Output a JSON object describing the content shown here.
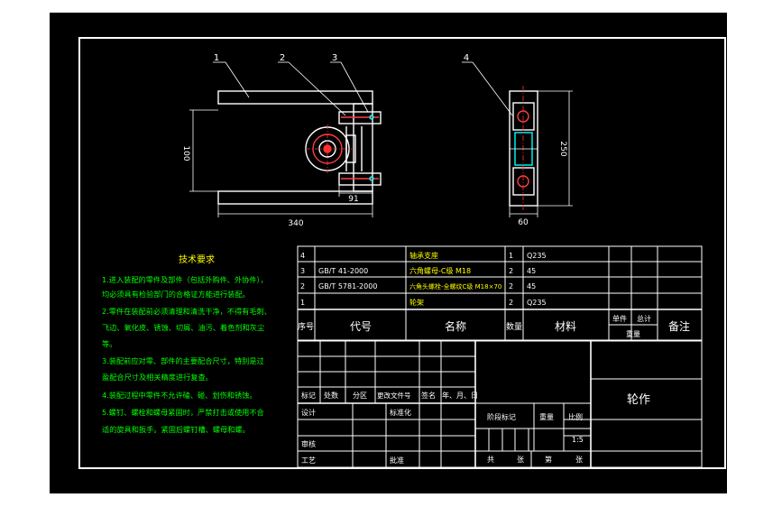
{
  "balloons": [
    "1",
    "2",
    "3",
    "4"
  ],
  "dimensions": {
    "height_left": "100",
    "width_91": "91",
    "width_total": "340",
    "height_right": "250",
    "width_60": "60"
  },
  "tech_requirements": {
    "title": "技术要求",
    "lines": [
      "1.进入装配的零件及部件（包括外购件、外协件），",
      "均必须具有检验部门的合格证方能进行装配。",
      "2.零件在装配前必须清理和清洗干净，不得有毛刺、",
      "飞边、氧化皮、锈蚀、切屑、油污、着色剂和灰尘",
      "等。",
      "3.装配前应对零、部件的主要配合尺寸，特别是过",
      "盈配合尺寸及相关精度进行复查。",
      "4.装配过程中零件不允许磕、碰、划伤和锈蚀。",
      "5.螺钉、螺栓和螺母紧固时，严禁打击或使用不合",
      "适的旋具和扳手。紧固后螺钉槽、螺母和螺。"
    ]
  },
  "bom": {
    "rows": [
      {
        "seq": "4",
        "code": "",
        "name": "轴承支座",
        "qty": "1",
        "material": "Q235"
      },
      {
        "seq": "3",
        "code": "GB/T 41-2000",
        "name": "六角螺母-C级 M18",
        "qty": "2",
        "material": "45"
      },
      {
        "seq": "2",
        "code": "GB/T 5781-2000",
        "name": "六角头螺栓-全螺纹C级 M18×70",
        "qty": "2",
        "material": "45"
      },
      {
        "seq": "1",
        "code": "",
        "name": "轮架",
        "qty": "2",
        "material": "Q235"
      }
    ],
    "header": {
      "seq": "序号",
      "code": "代号",
      "name": "名称",
      "qty": "数量",
      "material": "材料",
      "single": "单件",
      "total": "总计",
      "weight": "重量",
      "remark": "备注"
    }
  },
  "title_block": {
    "mark": "标记",
    "count": "处数",
    "zone": "分区",
    "change_doc": "更改文件号",
    "sign": "签名",
    "date": "年、月、日",
    "design": "设计",
    "standardize": "标准化",
    "stage_mark": "阶段标记",
    "weight": "重量",
    "scale": "比例",
    "scale_value": "1:5",
    "review": "审核",
    "process": "工艺",
    "approve": "批准",
    "sheets_total": "共",
    "sheets_label": "张",
    "sheet_no": "第",
    "sheet_label": "张",
    "drawing_name": "轮作"
  },
  "colors": {
    "background": "#000000",
    "border": "#ffffff",
    "text": "#ffffff",
    "tech_text": "#00ff00",
    "title_text": "#ffff00",
    "part": "#ffffff",
    "hatch": "#ff4040",
    "center": "#ff3030",
    "highlight": "#00ffff"
  }
}
